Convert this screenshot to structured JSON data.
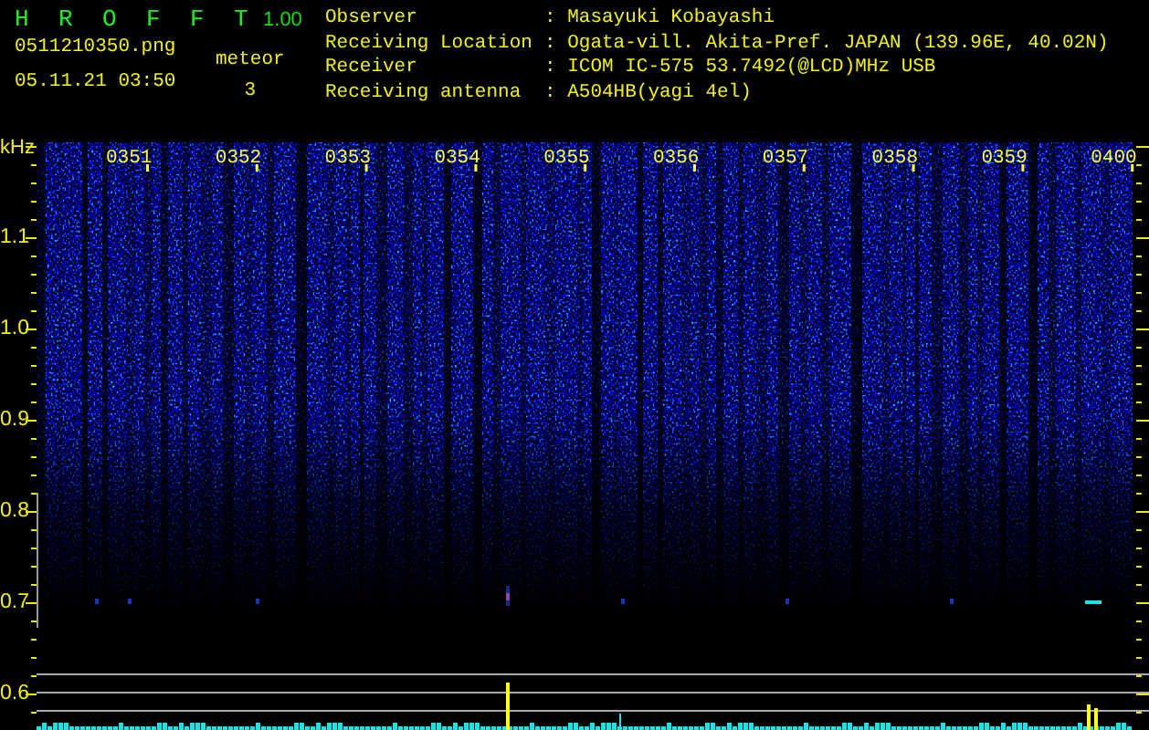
{
  "header": {
    "app_title": "H R O F F T",
    "version": "1.00",
    "file_name": "0511210350.png",
    "date_time": "05.11.21 03:50",
    "meteor_label": "meteor",
    "meteor_count": "3"
  },
  "station_info": [
    {
      "label": "Observer",
      "value": ": Masayuki Kobayashi"
    },
    {
      "label": "Receiving Location",
      "value": ": Ogata-vill. Akita-Pref. JAPAN (139.96E, 40.02N)"
    },
    {
      "label": "Receiver",
      "value": ": ICOM IC-575 53.7492(@LCD)MHz USB"
    },
    {
      "label": "Receiving antenna",
      "value": ": A504HB(yagi 4el)"
    }
  ],
  "frequency_axis": {
    "unit": "kHz",
    "labels": [
      "1.1",
      "1.0",
      "0.9",
      "0.8",
      "0.7",
      "0.6"
    ]
  },
  "time_labels": [
    "0351",
    "0352",
    "0353",
    "0354",
    "0355",
    "0356",
    "0357",
    "0358",
    "0359",
    "0400"
  ]
}
